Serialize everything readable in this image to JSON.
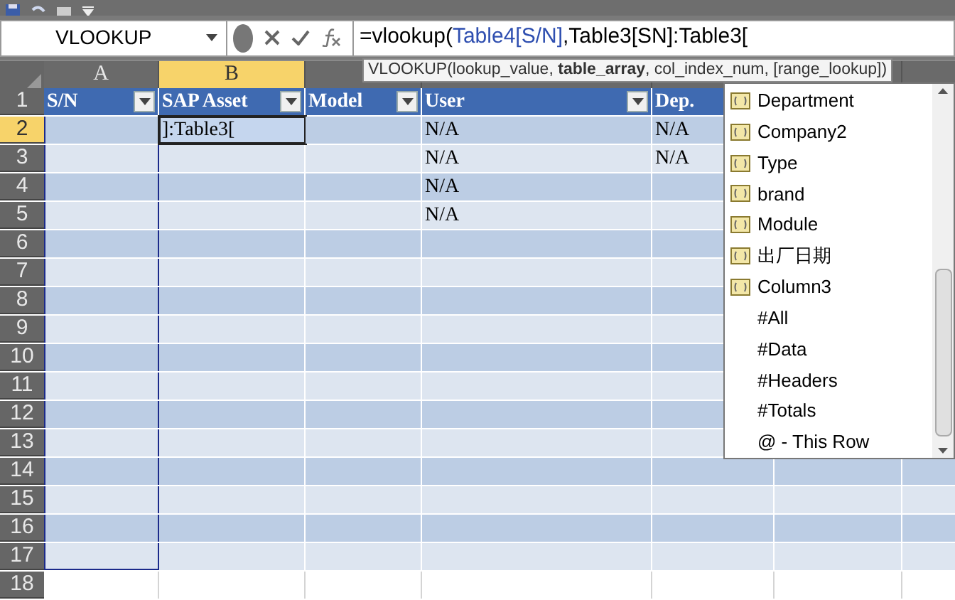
{
  "name_box": {
    "value": "VLOOKUP"
  },
  "formula_bar": {
    "parts": [
      {
        "text": "=vlookup(",
        "color": "#000000"
      },
      {
        "text": "Table4[S/N]",
        "color": "#2f4fb0"
      },
      {
        "text": ",Table3[SN]:Table3[",
        "color": "#000000"
      }
    ]
  },
  "tooltip": {
    "text": "VLOOKUP(lookup_value, **table_array**, col_index_num, [range_lookup])"
  },
  "columns": [
    {
      "label": "A",
      "selected": false
    },
    {
      "label": "B",
      "selected": true
    }
  ],
  "rows": [
    {
      "label": "1",
      "selected": false,
      "kind": "header",
      "cells": {
        "a": {
          "text": "S/N",
          "filter_button": true
        },
        "b": {
          "text": "SAP Asset",
          "filter_button": true
        },
        "c": {
          "text": "Model",
          "filter_button": true
        },
        "d": {
          "text": "User",
          "filter_button": true
        },
        "e": {
          "text": "Dep.",
          "filter_button": false
        }
      }
    },
    {
      "label": "2",
      "selected": true,
      "kind": "data",
      "cells": {
        "b": "]:Table3[",
        "d": "N/A",
        "e": "N/A"
      }
    },
    {
      "label": "3",
      "selected": false,
      "kind": "data",
      "cells": {
        "d": "N/A",
        "e": "N/A"
      }
    },
    {
      "label": "4",
      "selected": false,
      "kind": "data",
      "cells": {
        "d": "N/A"
      }
    },
    {
      "label": "5",
      "selected": false,
      "kind": "data",
      "cells": {
        "d": "N/A"
      }
    },
    {
      "label": "6",
      "selected": false,
      "kind": "data",
      "cells": {}
    },
    {
      "label": "7",
      "selected": false,
      "kind": "data",
      "cells": {}
    },
    {
      "label": "8",
      "selected": false,
      "kind": "data",
      "cells": {}
    },
    {
      "label": "9",
      "selected": false,
      "kind": "data",
      "cells": {}
    },
    {
      "label": "10",
      "selected": false,
      "kind": "data",
      "cells": {}
    },
    {
      "label": "11",
      "selected": false,
      "kind": "data",
      "cells": {}
    },
    {
      "label": "12",
      "selected": false,
      "kind": "data",
      "cells": {}
    },
    {
      "label": "13",
      "selected": false,
      "kind": "data",
      "cells": {}
    },
    {
      "label": "14",
      "selected": false,
      "kind": "data",
      "cells": {}
    },
    {
      "label": "15",
      "selected": false,
      "kind": "data",
      "cells": {}
    },
    {
      "label": "16",
      "selected": false,
      "kind": "data",
      "cells": {}
    },
    {
      "label": "17",
      "selected": false,
      "kind": "data",
      "cells": {}
    },
    {
      "label": "18",
      "selected": false,
      "kind": "outside",
      "cells": {}
    }
  ],
  "autocomplete": {
    "items": [
      {
        "label": "Department",
        "kind": "field"
      },
      {
        "label": "Company2",
        "kind": "field"
      },
      {
        "label": "Type",
        "kind": "field"
      },
      {
        "label": "brand",
        "kind": "field"
      },
      {
        "label": "Module",
        "kind": "field"
      },
      {
        "label": "出厂日期",
        "kind": "field"
      },
      {
        "label": "Column3",
        "kind": "field"
      },
      {
        "label": "#All",
        "kind": "special"
      },
      {
        "label": "#Data",
        "kind": "special"
      },
      {
        "label": "#Headers",
        "kind": "special"
      },
      {
        "label": "#Totals",
        "kind": "special"
      },
      {
        "label": "@ - This Row",
        "kind": "special"
      }
    ]
  }
}
